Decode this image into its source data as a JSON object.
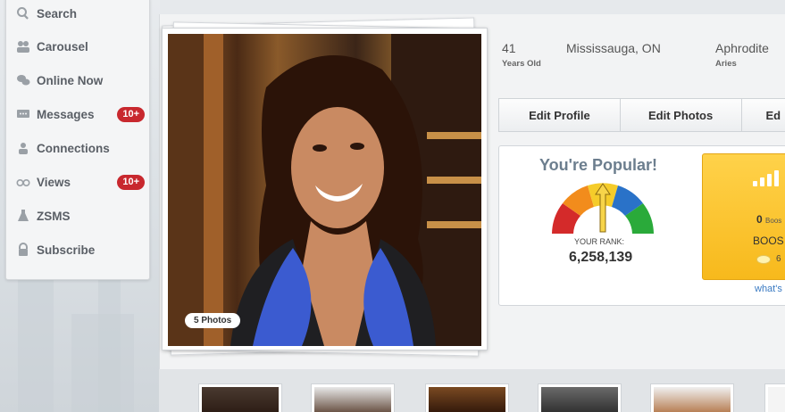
{
  "sidebar": {
    "items": [
      {
        "label": "Search",
        "icon": "search-icon"
      },
      {
        "label": "Carousel",
        "icon": "carousel-icon"
      },
      {
        "label": "Online Now",
        "icon": "online-icon"
      },
      {
        "label": "Messages",
        "icon": "messages-icon",
        "badge": "10+"
      },
      {
        "label": "Connections",
        "icon": "connections-icon"
      },
      {
        "label": "Views",
        "icon": "views-icon",
        "badge": "10+"
      },
      {
        "label": "ZSMS",
        "icon": "zsms-icon"
      },
      {
        "label": "Subscribe",
        "icon": "lock-icon"
      }
    ]
  },
  "profile": {
    "photo_count": "5 Photos",
    "stats": [
      {
        "value": "41",
        "label": "Years Old"
      },
      {
        "value": "Mississauga, ON",
        "label": ""
      },
      {
        "value": "Aphrodite",
        "label": "Aries"
      }
    ]
  },
  "actions": {
    "edit_profile": "Edit Profile",
    "edit_photos": "Edit Photos",
    "third_partial": "Ed"
  },
  "popularity": {
    "title": "You're Popular!",
    "rank_label": "YOUR RANK:",
    "rank_value": "6,258,139",
    "gauge_colors": [
      "#d42a2a",
      "#f28c1c",
      "#f5cc2a",
      "#2a72c8",
      "#2aaa3a"
    ]
  },
  "boost": {
    "count": "0",
    "count_suffix": "Boos",
    "label": "BOOS",
    "coins": "6",
    "link": "what's"
  },
  "colors": {
    "badge": "#c8282e",
    "accent_title": "#6c7e8e",
    "link": "#3a7ac2",
    "boost": "#f7b91c"
  }
}
